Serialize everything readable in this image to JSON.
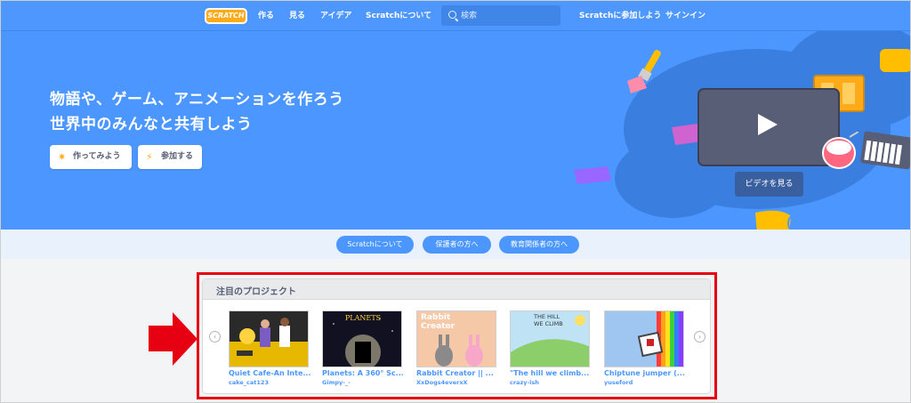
{
  "nav": {
    "logo": "SCRATCH",
    "items": [
      "作る",
      "見る",
      "アイデア",
      "Scratchについて"
    ],
    "search_placeholder": "検索",
    "join": "Scratchに参加しよう",
    "signin": "サインイン"
  },
  "hero": {
    "title_line1": "物語や、ゲーム、アニメーションを作ろう",
    "title_line2": "世界中のみんなと共有しよう",
    "create_button": "作ってみよう",
    "join_button": "参加する",
    "video_button": "ビデオを見る"
  },
  "links": [
    "Scratchについて",
    "保護者の方へ",
    "教育関係者の方へ"
  ],
  "featured": {
    "title": "注目のプロジェクト",
    "projects": [
      {
        "title": "Quiet Cafe-An Inte...",
        "author": "cake_cat123",
        "thumb_text": ""
      },
      {
        "title": "Planets: A 360° Sc...",
        "author": "Gimpy-_-",
        "thumb_text": "PLANETS"
      },
      {
        "title": "Rabbit Creator || ...",
        "author": "XxDogs4everxX",
        "thumb_text": "Rabbit Creator"
      },
      {
        "title": "\"The hill we climb...",
        "author": "crazy-ish",
        "thumb_text": "THE HILL WE CLIMB"
      },
      {
        "title": "Chiptune jumper (...",
        "author": "yuseford",
        "thumb_text": ""
      }
    ]
  },
  "colors": {
    "accent": "#4c97ff",
    "annotation": "#e60012",
    "logo": "#ffab19"
  }
}
